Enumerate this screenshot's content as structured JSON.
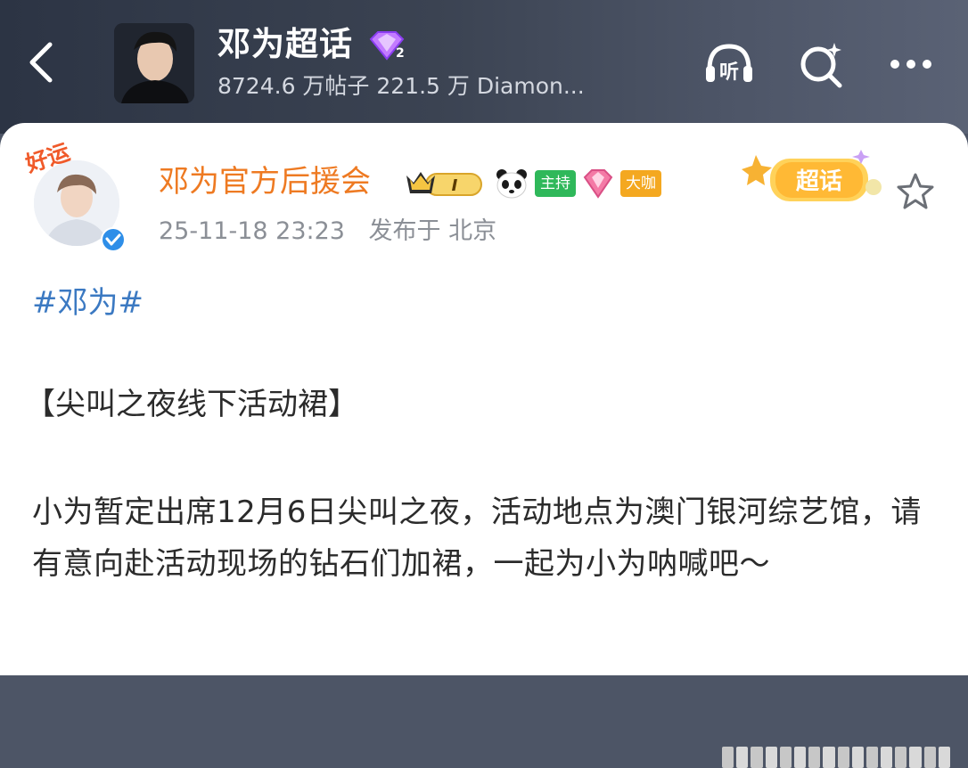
{
  "header": {
    "back_icon": "chevron-left-icon",
    "topic_name": "邓为超话",
    "topic_level_badge": "2",
    "stats": "8724.6 万帖子  221.5 万 Diamon...",
    "listen_label": "听",
    "listen_icon": "headphones-icon",
    "search_icon": "sparkle-search-icon",
    "more_icon": "more-dots-icon"
  },
  "post": {
    "avatar_tag": "好运",
    "author": "邓为官方后援会",
    "crown_badge_text": "I",
    "host_tag": "主持",
    "big_tag": "大咖",
    "timestamp": "25-11-18 23:23",
    "location_prefix": "发布于",
    "location": "北京",
    "supertopic_badge": "超话",
    "hashtag": "#邓为#",
    "title": "【尖叫之夜线下活动裙】",
    "body": "小为暂定出席12月6日尖叫之夜，活动地点为澳门银河综艺馆，请有意向赴活动现场的钻石们加裙，一起为小为呐喊吧～"
  },
  "colors": {
    "author": "#ee7a22",
    "hashtag": "#3b79c2",
    "meta": "#8b8f96",
    "header_bg": "#3b4352",
    "host_tag": "#2fb85a",
    "big_tag": "#f4a820"
  }
}
